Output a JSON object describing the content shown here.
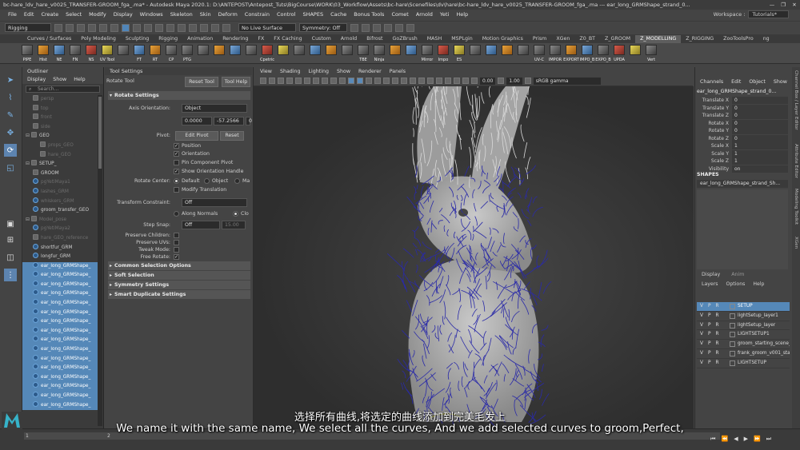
{
  "titlebar": {
    "text": "bc-hare_ldv_hare_v0025_TRANSFER-GROOM_fga_.ma* - Autodesk Maya 2020.1: D:\\ANTEPOST\\Antepost_Tuts\\BigCourse\\WORK\\03_Workflow\\Assets\\bc-hare\\Scenefiles\\dv\\hare\\bc-hare_ldv_hare_v0025_TRANSFER-GROOM_fga_.ma  ---  ear_long_GRMShape_strand_0...",
    "minimize": "—",
    "maximize": "❐",
    "close": "✕"
  },
  "menubar": {
    "items": [
      "File",
      "Edit",
      "Create",
      "Select",
      "Modify",
      "Display",
      "Windows",
      "Skeleton",
      "Skin",
      "Deform",
      "Constrain",
      "Control",
      "SHAPES",
      "Cache",
      "Bonus Tools",
      "Comet",
      "Arnold",
      "Yeti",
      "Help"
    ],
    "workspace_label": "Workspace :",
    "workspace_value": "Tutorials*"
  },
  "statusline": {
    "menu_set": "Rigging",
    "live_surface": "No Live Surface",
    "symmetry": "Symmetry: Off"
  },
  "shelf": {
    "tabs": [
      "Curves / Surfaces",
      "Poly Modeling",
      "Sculpting",
      "Rigging",
      "Animation",
      "Rendering",
      "FX",
      "FX Caching",
      "Custom",
      "Arnold",
      "Bifrost",
      "GoZBrush",
      "MASH",
      "MSPLgin",
      "Motion Graphics",
      "Prism",
      "XGen",
      "Z0_BT",
      "Z_GROOM",
      "Z_MODELLING",
      "Z_RIGGING",
      "ZooToolsPro",
      "ng"
    ],
    "active_tab": "Z_MODELLING",
    "buttons": [
      "PIPE",
      "Hist",
      "NE",
      "FN",
      "NS",
      "UV Tool",
      "",
      "FT",
      "RT",
      "CP",
      "PTG",
      "",
      "",
      "",
      "",
      "Cpetric",
      "",
      "",
      "",
      "",
      "",
      "TBE",
      "Ninja",
      "",
      "",
      "Mirror",
      "Impo",
      "ES",
      "",
      "",
      "",
      "",
      "UV-C",
      "IMPOR",
      "EXPORT",
      "IMPO_B",
      "EXPO_B",
      "UPDA",
      "",
      "Vert"
    ]
  },
  "outliner": {
    "title": "Outliner",
    "menu": [
      "Display",
      "Show",
      "Help"
    ],
    "search_placeholder": "Search...",
    "rows": [
      {
        "label": "persp",
        "type": "cam",
        "dim": true,
        "sel": false,
        "indent": 1
      },
      {
        "label": "top",
        "type": "cam",
        "dim": true,
        "sel": false,
        "indent": 1
      },
      {
        "label": "front",
        "type": "cam",
        "dim": true,
        "sel": false,
        "indent": 1
      },
      {
        "label": "side",
        "type": "cam",
        "dim": true,
        "sel": false,
        "indent": 1
      },
      {
        "label": "GEO",
        "type": "grp",
        "dim": false,
        "sel": false,
        "indent": 0,
        "arrow": "⊟"
      },
      {
        "label": "props_GEO",
        "type": "grp",
        "dim": true,
        "sel": false,
        "indent": 2
      },
      {
        "label": "hare_GEO",
        "type": "grp",
        "dim": true,
        "sel": false,
        "indent": 2
      },
      {
        "label": "SETUP_",
        "type": "grp",
        "dim": false,
        "sel": false,
        "indent": 0,
        "arrow": "⊟"
      },
      {
        "label": "GROOM",
        "type": "grp",
        "dim": false,
        "sel": false,
        "indent": 1
      },
      {
        "label": "pgYetiMaya1",
        "type": "cv",
        "dim": true,
        "sel": false,
        "indent": 1
      },
      {
        "label": "lashes_GRM",
        "type": "cv",
        "dim": true,
        "sel": false,
        "indent": 1
      },
      {
        "label": "whiskers_GRM",
        "type": "cv",
        "dim": true,
        "sel": false,
        "indent": 1
      },
      {
        "label": "groom_transfer_GEO",
        "type": "cv",
        "dim": false,
        "sel": false,
        "indent": 1
      },
      {
        "label": "Model_pose",
        "type": "grp",
        "dim": true,
        "sel": false,
        "indent": 0,
        "arrow": "⊟"
      },
      {
        "label": "pgYetiMaya2",
        "type": "cv",
        "dim": true,
        "sel": false,
        "indent": 1
      },
      {
        "label": "hare_GEO_reference",
        "type": "grp",
        "dim": true,
        "sel": false,
        "indent": 1
      },
      {
        "label": "shortfur_GRM",
        "type": "cv",
        "dim": false,
        "sel": false,
        "indent": 1
      },
      {
        "label": "longfur_GRM",
        "type": "cv",
        "dim": false,
        "sel": false,
        "indent": 1
      },
      {
        "label": "ear_long_GRMShape_",
        "type": "cv",
        "dim": false,
        "sel": true,
        "indent": 1
      },
      {
        "label": "ear_long_GRMShape_",
        "type": "cv",
        "dim": false,
        "sel": true,
        "indent": 1
      },
      {
        "label": "ear_long_GRMShape_",
        "type": "cv",
        "dim": false,
        "sel": true,
        "indent": 1
      },
      {
        "label": "ear_long_GRMShape_",
        "type": "cv",
        "dim": false,
        "sel": true,
        "indent": 1
      },
      {
        "label": "ear_long_GRMShape_",
        "type": "cv",
        "dim": false,
        "sel": true,
        "indent": 1
      },
      {
        "label": "ear_long_GRMShape_",
        "type": "cv",
        "dim": false,
        "sel": true,
        "indent": 1
      },
      {
        "label": "ear_long_GRMShape_",
        "type": "cv",
        "dim": false,
        "sel": true,
        "indent": 1
      },
      {
        "label": "ear_long_GRMShape_",
        "type": "cv",
        "dim": false,
        "sel": true,
        "indent": 1
      },
      {
        "label": "ear_long_GRMShape_",
        "type": "cv",
        "dim": false,
        "sel": true,
        "indent": 1
      },
      {
        "label": "ear_long_GRMShape_",
        "type": "cv",
        "dim": false,
        "sel": true,
        "indent": 1
      },
      {
        "label": "ear_long_GRMShape_",
        "type": "cv",
        "dim": false,
        "sel": true,
        "indent": 1
      },
      {
        "label": "ear_long_GRMShape_",
        "type": "cv",
        "dim": false,
        "sel": true,
        "indent": 1
      },
      {
        "label": "ear_long_GRMShape_",
        "type": "cv",
        "dim": false,
        "sel": true,
        "indent": 1
      },
      {
        "label": "ear_long_GRMShape_",
        "type": "cv",
        "dim": false,
        "sel": true,
        "indent": 1
      },
      {
        "label": "ear_long_GRMShape_",
        "type": "cv",
        "dim": false,
        "sel": true,
        "indent": 1
      },
      {
        "label": "ear_long_GRMShape_",
        "type": "cv",
        "dim": false,
        "sel": true,
        "indent": 1
      }
    ]
  },
  "toolsettings": {
    "title": "Tool Settings",
    "tool_name": "Rotate Tool",
    "reset_tool": "Reset Tool",
    "tool_help": "Tool Help",
    "sec_rotate": "Rotate Settings",
    "axis_orientation_label": "Axis Orientation:",
    "axis_orientation_value": "Object",
    "axis_x": "0.0000",
    "axis_y": "-57.2566",
    "axis_z": "0",
    "pivot_label": "Pivot:",
    "edit_pivot": "Edit Pivot",
    "reset": "Reset",
    "opt_position": "Position",
    "opt_orientation": "Orientation",
    "opt_pin": "Pin Component Pivot",
    "opt_show_handle": "Show Orientation Handle",
    "rotate_center_label": "Rotate Center:",
    "rc_default": "Default",
    "rc_object": "Object",
    "rc_ma": "Ma",
    "modify_translation": "Modify Translation",
    "transform_constraint_label": "Transform Constraint:",
    "transform_constraint_value": "Off",
    "along_normals": "Along Normals",
    "closest": "Clo",
    "step_snap_label": "Step Snap:",
    "step_snap_value": "Off",
    "step_snap_num": "15.00",
    "preserve_children": "Preserve Children:",
    "preserve_uvs": "Preserve UVs:",
    "tweak_mode": "Tweak Mode:",
    "free_rotate": "Free Rotate:",
    "sec_common": "Common Selection Options",
    "sec_soft": "Soft Selection",
    "sec_symmetry": "Symmetry Settings",
    "sec_smart": "Smart Duplicate Settings"
  },
  "viewport": {
    "menu": [
      "View",
      "Shading",
      "Lighting",
      "Show",
      "Renderer",
      "Panels"
    ],
    "field_a": "0.00",
    "field_b": "1.00",
    "colorspace": "sRGB gamma"
  },
  "channelbox": {
    "side_label": "Channel Box / Layer Editor",
    "menu": [
      "Channels",
      "Edit",
      "Object",
      "Show"
    ],
    "object_name": "ear_long_GRMShape_strand_0...",
    "attrs": [
      {
        "name": "Translate X",
        "value": "0"
      },
      {
        "name": "Translate Y",
        "value": "0"
      },
      {
        "name": "Translate Z",
        "value": "0"
      },
      {
        "name": "Rotate X",
        "value": "0"
      },
      {
        "name": "Rotate Y",
        "value": "0"
      },
      {
        "name": "Rotate Z",
        "value": "0"
      },
      {
        "name": "Scale X",
        "value": "1"
      },
      {
        "name": "Scale Y",
        "value": "1"
      },
      {
        "name": "Scale Z",
        "value": "1"
      },
      {
        "name": "Visibility",
        "value": "on"
      }
    ],
    "shapes_label": "SHAPES",
    "shape_name": "ear_long_GRMShape_strand_Sh..."
  },
  "layers": {
    "tabs": [
      "Display",
      "Anim"
    ],
    "menu": [
      "Layers",
      "Options",
      "Help"
    ],
    "rows": [
      {
        "label": "SETUP",
        "sel": true
      },
      {
        "label": "lightSetup_layer1",
        "sel": false
      },
      {
        "label": "lightSetup_layer",
        "sel": false
      },
      {
        "label": "LIGHTSETUP1",
        "sel": false
      },
      {
        "label": "groom_starting_scene_L",
        "sel": false
      },
      {
        "label": "frank_groom_v001_start",
        "sel": false
      },
      {
        "label": "LIGHTSETUP",
        "sel": false
      }
    ],
    "vpr": "VPR"
  },
  "sidetabs": [
    "Channel Box / Layer Editor",
    "Attribute Editor",
    "Modeling Toolkit",
    "XGen"
  ],
  "timeline": {
    "start": "1",
    "ticks": [
      "1",
      "2"
    ]
  },
  "subtitles": {
    "chinese": "选择所有曲线,将选定的曲线添加到完美毛发上",
    "english": "We name it with the same name, We select all the curves, And we add selected curves to groom,Perfect,"
  },
  "logo": "M",
  "colors": {
    "selection": "#5588b8",
    "curves": "#2a2aa8",
    "mesh": "#b9b9b9"
  }
}
